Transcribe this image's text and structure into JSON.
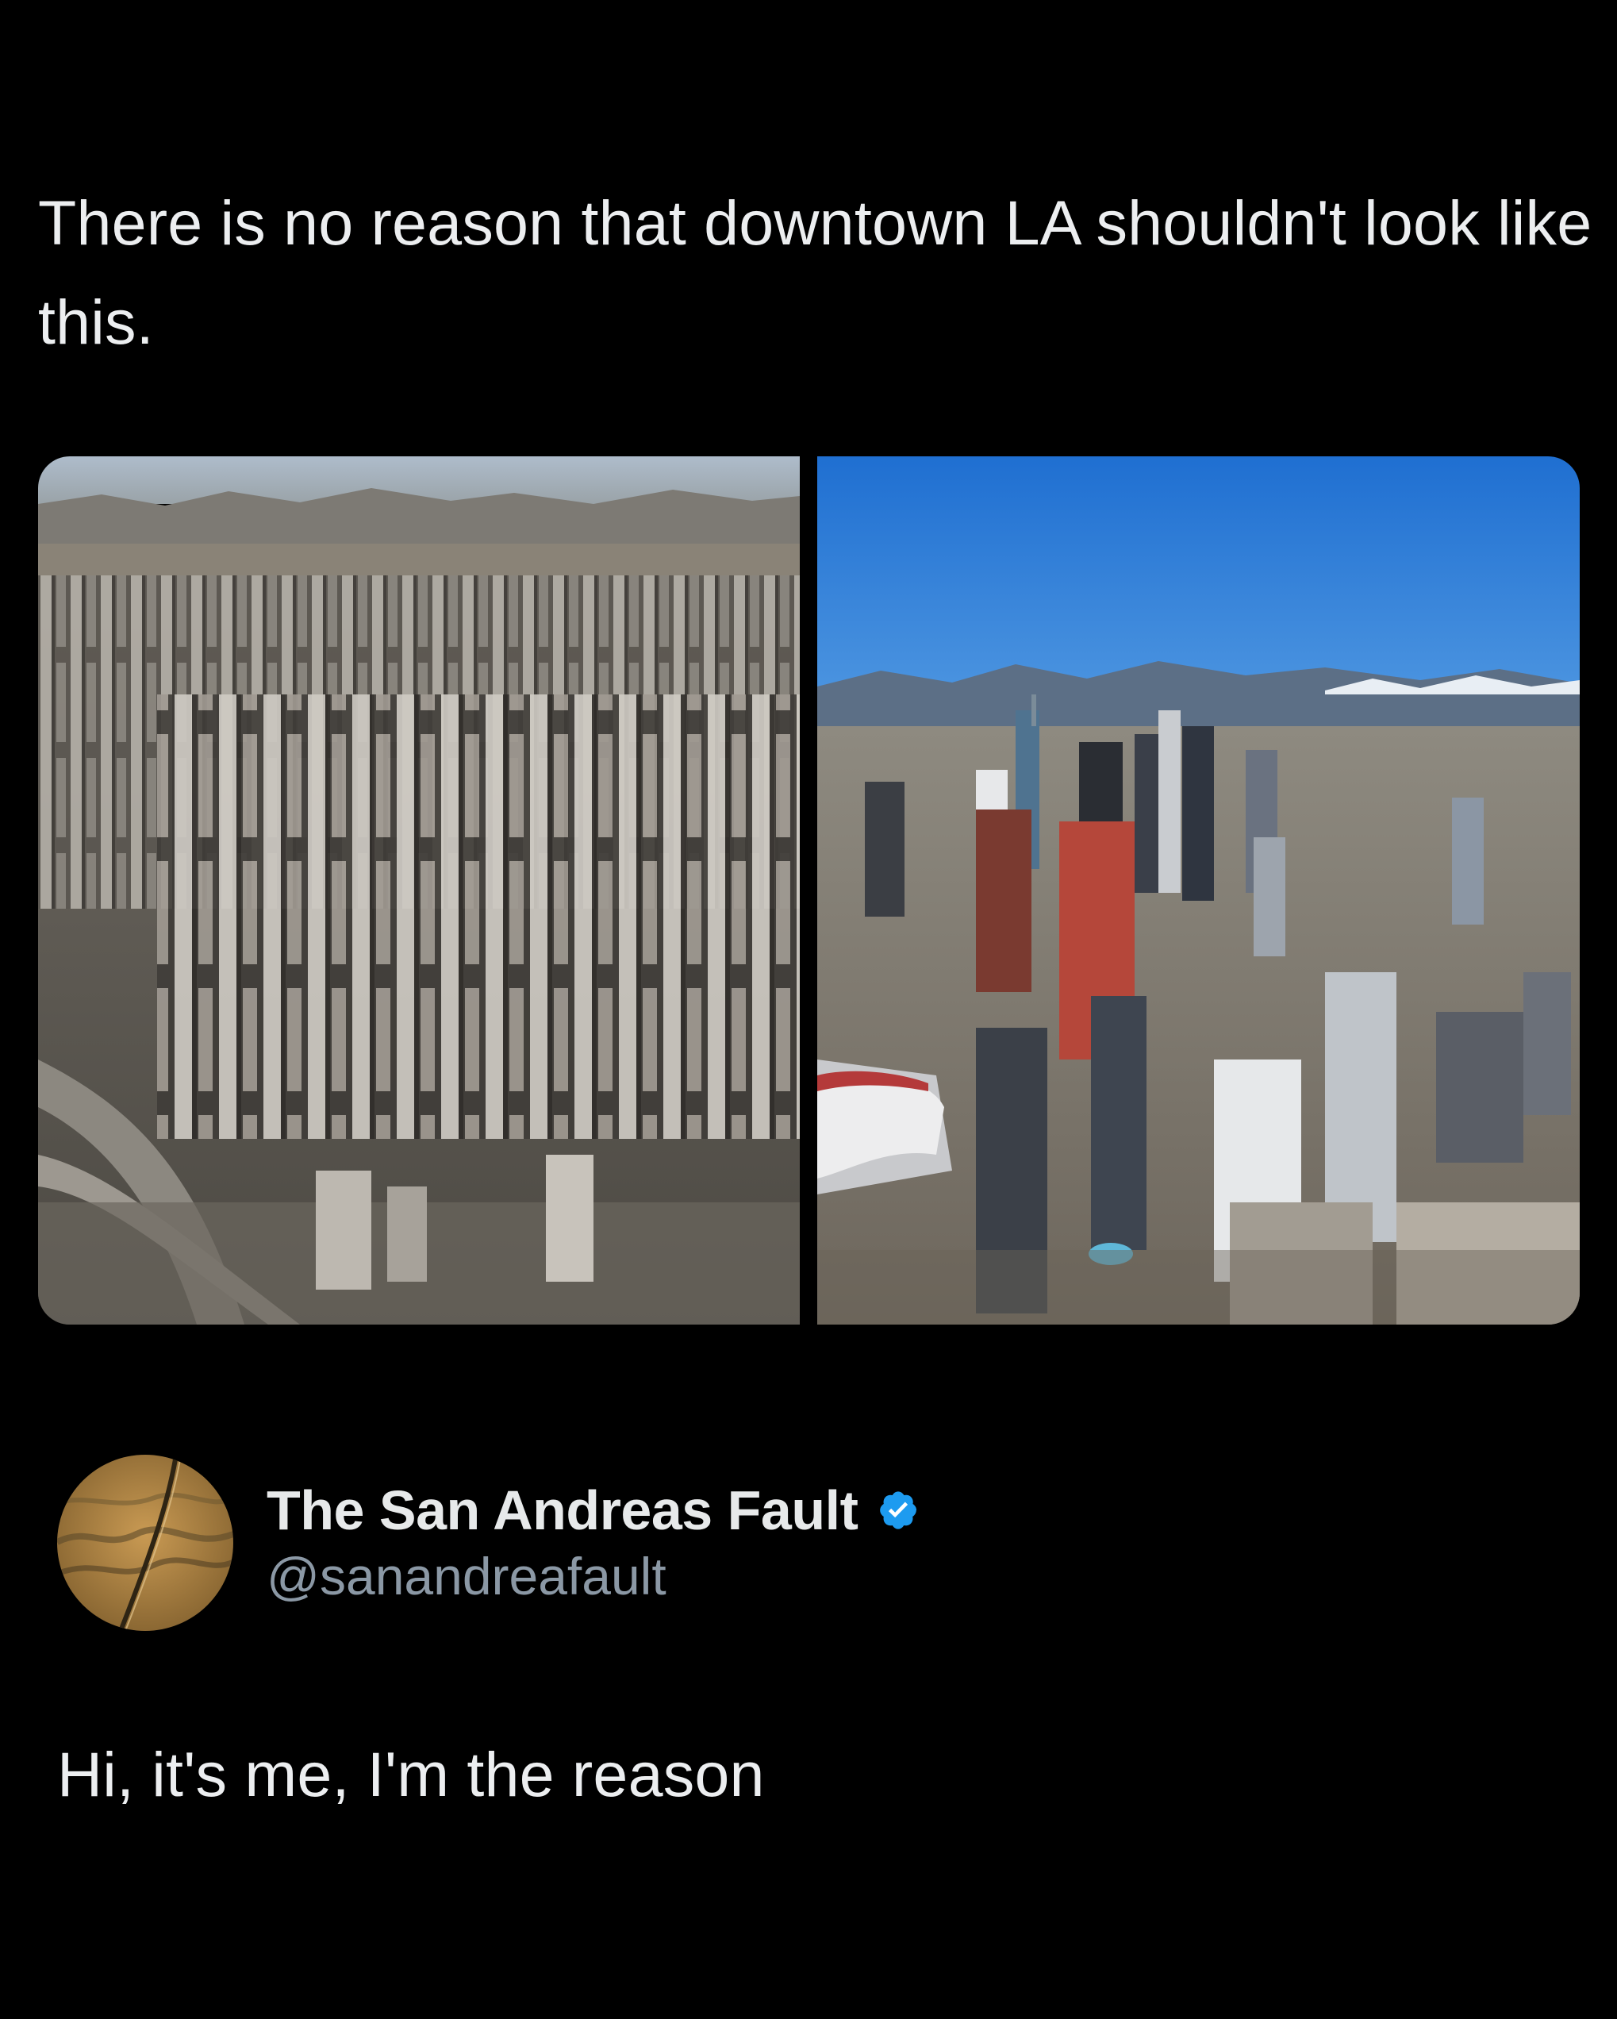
{
  "tweet": {
    "text": "There is no reason that downtown LA shouldn't look like this.",
    "media": [
      {
        "name": "dense-skyscraper-city-image"
      },
      {
        "name": "downtown-la-aerial-image"
      }
    ]
  },
  "reply": {
    "display_name": "The San Andreas Fault",
    "handle": "@sanandreafault",
    "verified": true,
    "text": "Hi, it's me, I'm the reason"
  },
  "colors": {
    "background": "#000000",
    "text": "#e7e9ea",
    "secondary_text": "#8b98a5",
    "verified_blue": "#1d9bf0"
  },
  "icons": {
    "verified": "verified-badge-icon",
    "avatar": "fault-line-avatar"
  }
}
